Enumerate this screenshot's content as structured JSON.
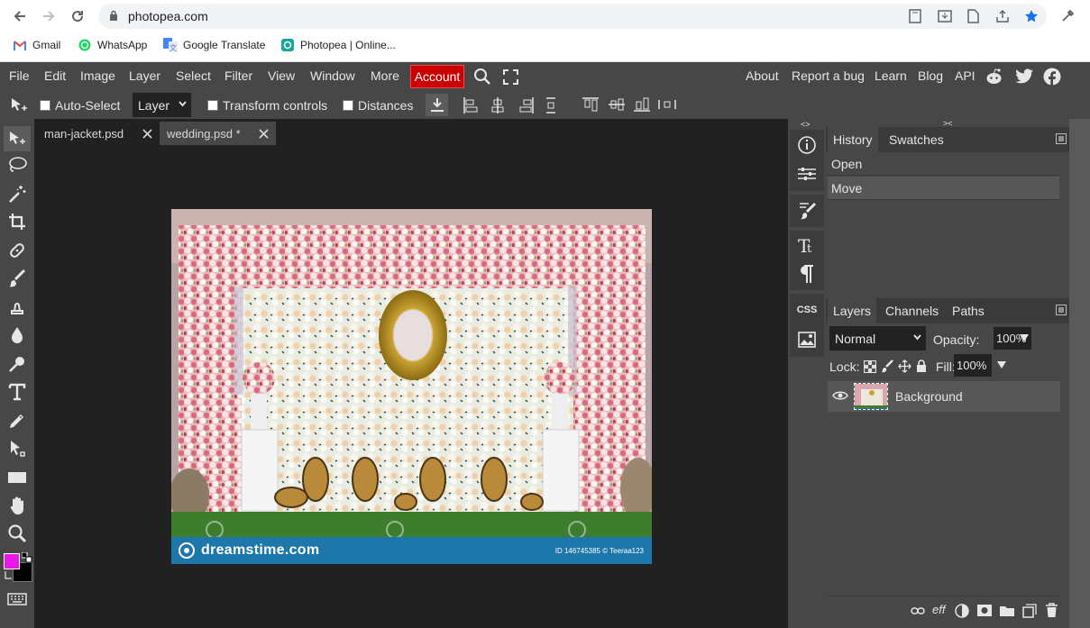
{
  "browser": {
    "url": "photopea.com",
    "bookmarks": [
      "Gmail",
      "WhatsApp",
      "Google Translate",
      "Photopea | Online..."
    ]
  },
  "menu": {
    "items": [
      "File",
      "Edit",
      "Image",
      "Layer",
      "Select",
      "Filter",
      "View",
      "Window",
      "More"
    ],
    "account": "Account",
    "right_links": [
      "About",
      "Report a bug",
      "Learn",
      "Blog",
      "API"
    ]
  },
  "options": {
    "auto_select": "Auto-Select",
    "layer_select": "Layer",
    "transform_controls": "Transform controls",
    "distances": "Distances"
  },
  "tabs": [
    {
      "label": "man-jacket.psd"
    },
    {
      "label": "wedding.psd *"
    }
  ],
  "canvas": {
    "watermark_brand": "dreamstime.com",
    "watermark_id": "ID 146745385 © Teeraa123"
  },
  "history_panel": {
    "tabs": [
      "History",
      "Swatches"
    ],
    "items": [
      "Open",
      "Move"
    ]
  },
  "layers_panel": {
    "tabs": [
      "Layers",
      "Channels",
      "Paths"
    ],
    "blend_mode": "Normal",
    "opacity_label": "Opacity:",
    "opacity_value": "100%",
    "lock_label": "Lock:",
    "fill_label": "Fill:",
    "fill_value": "100%",
    "layers": [
      {
        "name": "Background"
      }
    ]
  },
  "strip": {
    "css_label": "CSS"
  },
  "colors": {
    "foreground": "#e619e6",
    "background": "#000000",
    "accent": "#cc0000"
  }
}
